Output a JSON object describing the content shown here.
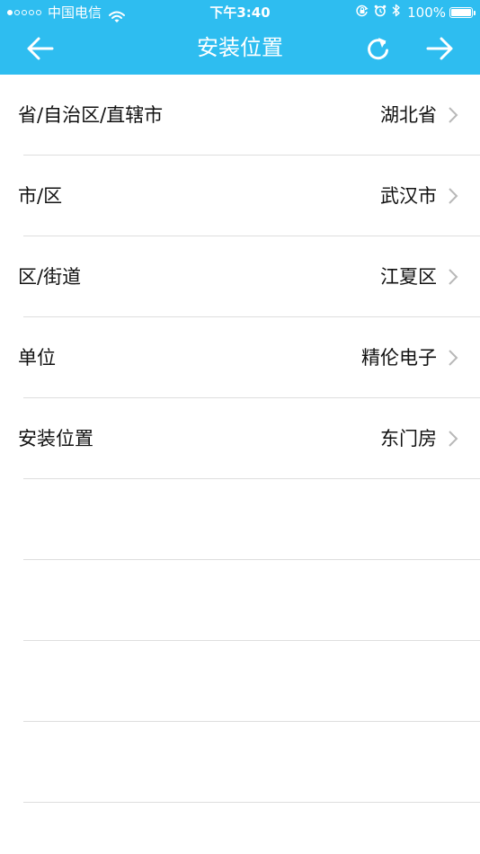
{
  "status_bar": {
    "carrier": "中国电信",
    "time": "下午3:40",
    "battery": "100%",
    "signal_strength": "1 of 5"
  },
  "nav": {
    "title": "安装位置",
    "back_icon": "arrow-left-icon",
    "refresh_icon": "refresh-icon",
    "forward_icon": "arrow-right-icon"
  },
  "rows": [
    {
      "label": "省/自治区/直辖市",
      "value": "湖北省"
    },
    {
      "label": "市/区",
      "value": "武汉市"
    },
    {
      "label": "区/街道",
      "value": "江夏区"
    },
    {
      "label": "单位",
      "value": "精伦电子"
    },
    {
      "label": "安装位置",
      "value": "东门房"
    }
  ],
  "colors": {
    "header": "#2ebdf0",
    "separator": "#dedede",
    "chevron": "#b8b8b8",
    "text": "#111111"
  }
}
